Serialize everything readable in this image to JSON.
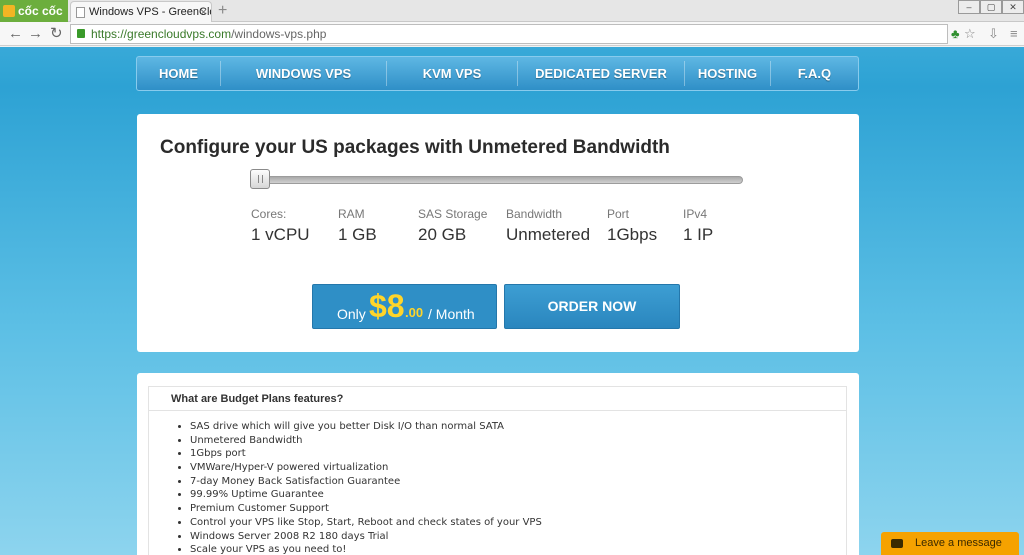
{
  "browser": {
    "brand": "cốc cốc",
    "tab_title": "Windows VPS - GreenCloud",
    "tab_close": "×",
    "new_tab": "+",
    "url_host": "https://greencloudvps.com",
    "url_path": "/windows-vps.php",
    "window_controls": [
      "–",
      "▢",
      "✕"
    ]
  },
  "nav": {
    "items": [
      "HOME",
      "WINDOWS VPS",
      "KVM VPS",
      "DEDICATED SERVER",
      "HOSTING",
      "F.A.Q"
    ]
  },
  "config": {
    "title": "Configure your US packages with Unmetered Bandwidth",
    "slider_value": 0,
    "specs": [
      {
        "label": "Cores:",
        "value": "1 vCPU"
      },
      {
        "label": "RAM",
        "value": "1 GB"
      },
      {
        "label": "SAS Storage",
        "value": "20 GB"
      },
      {
        "label": "Bandwidth",
        "value": "Unmetered"
      },
      {
        "label": "Port",
        "value": "1Gbps"
      },
      {
        "label": "IPv4",
        "value": "1 IP"
      }
    ],
    "price": {
      "prefix": "Only",
      "amount": "$8",
      "cents": ".00",
      "suffix": "/ Month"
    },
    "order_label": "ORDER NOW"
  },
  "features": {
    "heading": "What are Budget Plans features?",
    "items": [
      "SAS drive which will give you better Disk I/O than normal SATA",
      "Unmetered Bandwidth",
      "1Gbps port",
      "VMWare/Hyper-V powered virtualization",
      "7-day Money Back Satisfaction Guarantee",
      "99.99% Uptime Guarantee",
      "Premium Customer Support",
      "Control your VPS like Stop, Start, Reboot and check states of your VPS",
      "Windows Server 2008 R2 180 days Trial",
      "Scale your VPS as you need to!"
    ]
  },
  "chat": {
    "label": "Leave a message"
  },
  "colors": {
    "accent": "#2f8fc6",
    "price": "#ffd52a",
    "chat": "#f5a200"
  }
}
